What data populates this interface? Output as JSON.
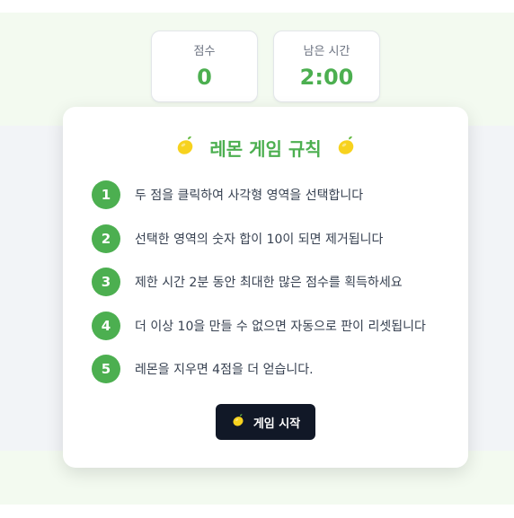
{
  "scoreboard": {
    "score_label": "점수",
    "score_value": "0",
    "time_label": "남은 시간",
    "time_value": "2:00"
  },
  "rules_modal": {
    "title": "레몬 게임 규칙",
    "rules": [
      {
        "number": "1",
        "text": "두 점을 클릭하여 사각형 영역을 선택합니다"
      },
      {
        "number": "2",
        "text": "선택한 영역의 숫자 합이 10이 되면 제거됩니다"
      },
      {
        "number": "3",
        "text": "제한 시간 2분 동안 최대한 많은 점수를 획득하세요"
      },
      {
        "number": "4",
        "text": "더 이상 10을 만들 수 없으면 자동으로 판이 리셋됩니다"
      },
      {
        "number": "5",
        "text": "레몬을 지우면 4점을 더 얻습니다."
      }
    ],
    "start_label": "게임 시작"
  },
  "icons": {
    "lemon": "lemon-icon"
  },
  "colors": {
    "accent": "#4caf50",
    "button_bg": "#111827",
    "lemon": "#f7d21e"
  }
}
